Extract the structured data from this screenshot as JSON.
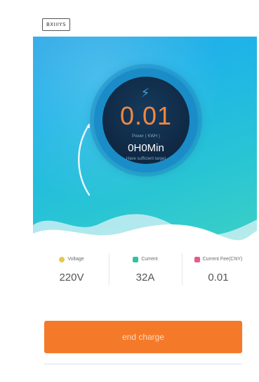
{
  "header": {
    "tag_text": "BXIIIYS"
  },
  "charger": {
    "power_value": "0.01",
    "power_label": "Power ( KWH )",
    "time_value": "0H0Min",
    "time_label": "Have sufficient target",
    "icon": "bolt-icon"
  },
  "stats": [
    {
      "label": "Voltage",
      "value": "220V",
      "color": "#e8c84a"
    },
    {
      "label": "Current",
      "value": "32A",
      "color": "#2ec4a0"
    },
    {
      "label": "Current Fee(CNY)",
      "value": "0.01",
      "color": "#e85a8a"
    }
  ],
  "actions": {
    "end_charge_label": "end charge"
  },
  "colors": {
    "accent": "#f47a2a",
    "hero_top": "#2aa7e6",
    "hero_bottom": "#3ad0c6",
    "dial": "#0f2843",
    "power_value": "#f5873f"
  }
}
